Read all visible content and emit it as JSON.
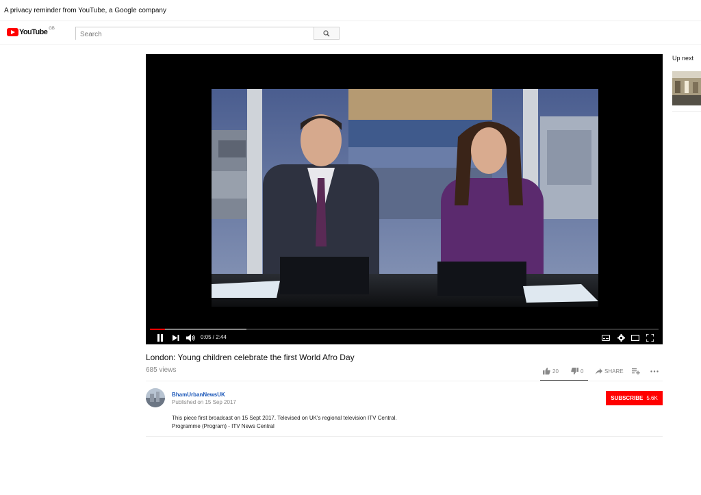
{
  "privacy_bar": {
    "text": "A privacy reminder from YouTube, a Google company"
  },
  "masthead": {
    "logo_text": "YouTube",
    "country_code": "GB",
    "search_placeholder": "Search",
    "search_icon": "search-icon"
  },
  "player": {
    "current_time": "0:05",
    "duration": "2:44",
    "time_display": "0:05 / 2:44",
    "progress_fraction": 0.03,
    "loaded_fraction": 0.19,
    "controls": [
      "pause-icon",
      "next-icon",
      "volume-icon",
      "captions-icon",
      "settings-icon",
      "theater-icon",
      "fullscreen-icon"
    ]
  },
  "sidebar": {
    "up_next_label": "Up next"
  },
  "video": {
    "title": "London: Young children celebrate the first World Afro Day",
    "views": "685 views",
    "likes": "20",
    "dislikes": "0",
    "share_label": "SHARE"
  },
  "channel": {
    "name": "BhamUrbanNewsUK",
    "published": "Published on 15 Sep 2017",
    "subscribe_label": "SUBSCRIBE",
    "subscriber_count": "5.6K"
  },
  "description": {
    "line1": "This piece first broadcast on 15 Sept 2017. Televised on UK's regional television ITV Central.",
    "line2": "Programme (Program) - ITV News Central"
  },
  "colors": {
    "brand_red": "#ff0000",
    "link_blue": "#1a56b8",
    "muted_text": "#888888"
  }
}
